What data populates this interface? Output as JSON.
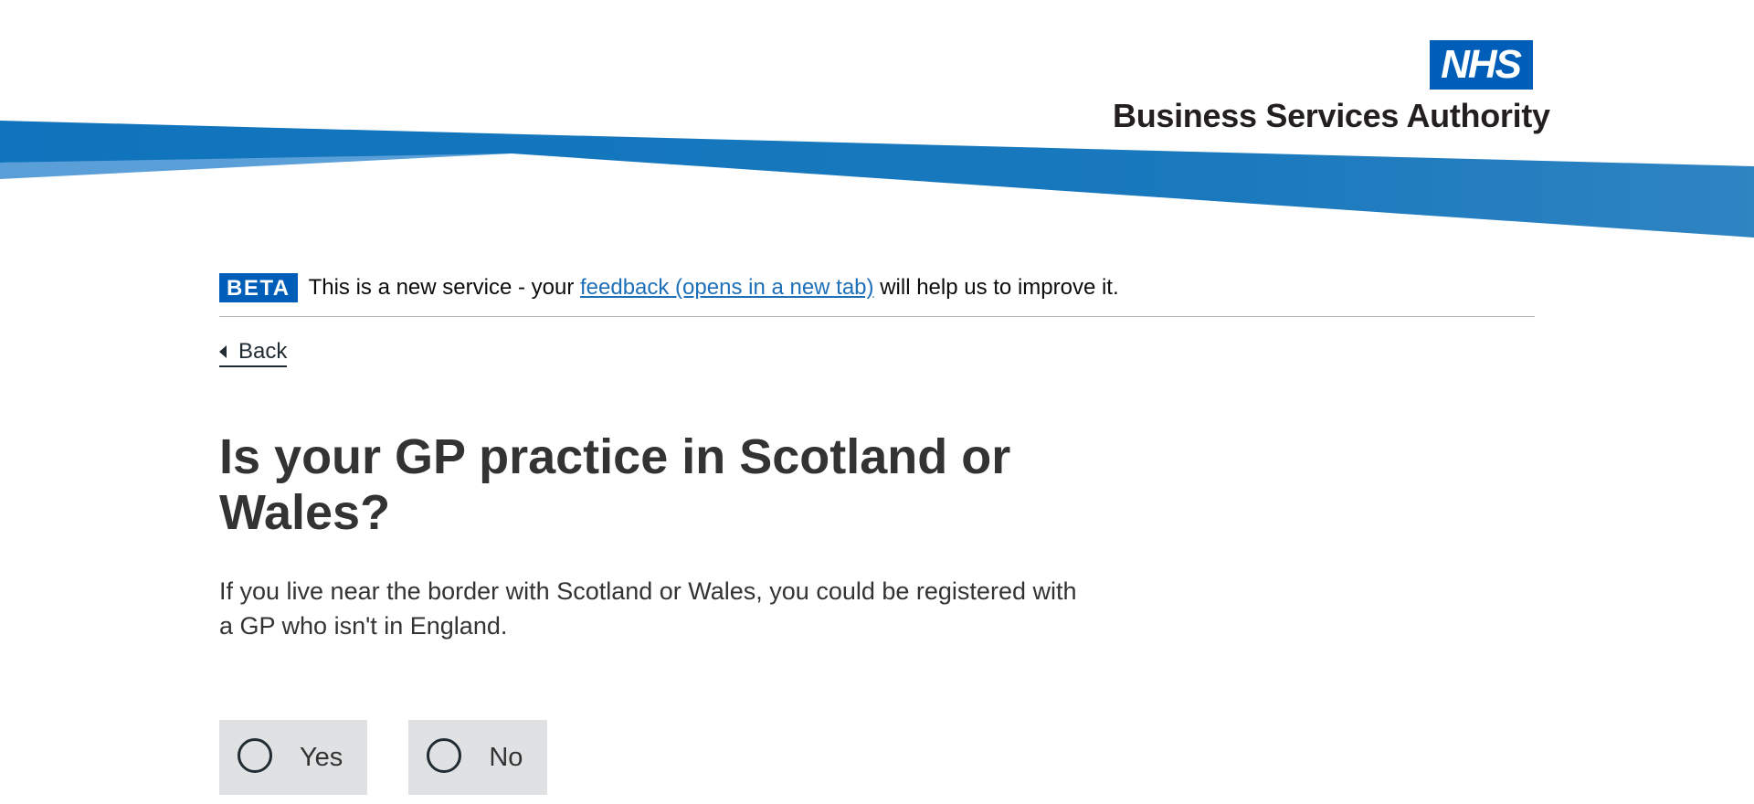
{
  "header": {
    "logo_mark": "NHS",
    "org_name": "Business Services Authority"
  },
  "phase_banner": {
    "tag": "BETA",
    "text_before": "This is a new service - your ",
    "link_text": "feedback (opens in a new tab)",
    "text_after": " will help us to improve it."
  },
  "back_link": {
    "label": "Back"
  },
  "question": {
    "title": "Is your GP practice in Scotland or Wales?",
    "hint": "If you live near the border with Scotland or Wales, you could be registered with a GP who isn't in England."
  },
  "options": [
    {
      "label": "Yes",
      "selected": false
    },
    {
      "label": "No",
      "selected": false
    }
  ],
  "colors": {
    "brand_blue": "#005eb8",
    "swoosh_dark": "#0f74bd",
    "swoosh_light": "#5b9fd8",
    "radio_bg": "#dfe1e3",
    "link": "#1d70b8",
    "text": "#333333"
  }
}
